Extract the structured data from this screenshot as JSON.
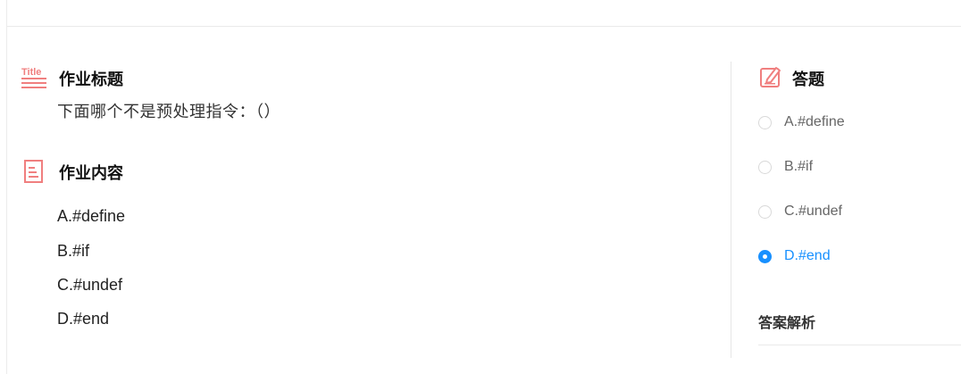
{
  "homework": {
    "title_section": {
      "icon": "title-icon",
      "icon_text": "Title",
      "heading": "作业标题",
      "question": "下面哪个不是预处理指令：（）"
    },
    "content_section": {
      "icon": "document-icon",
      "heading": "作业内容",
      "options": [
        "A.#define",
        "B.#if",
        "C.#undef",
        "D.#end"
      ]
    }
  },
  "answer_panel": {
    "icon": "edit-icon",
    "heading": "答题",
    "choices": [
      {
        "label": "A.#define",
        "selected": false
      },
      {
        "label": "B.#if",
        "selected": false
      },
      {
        "label": "C.#undef",
        "selected": false
      },
      {
        "label": "D.#end",
        "selected": true
      }
    ],
    "analysis_heading": "答案解析"
  },
  "colors": {
    "accent": "#1890ff",
    "icon": "#f07f7f"
  }
}
